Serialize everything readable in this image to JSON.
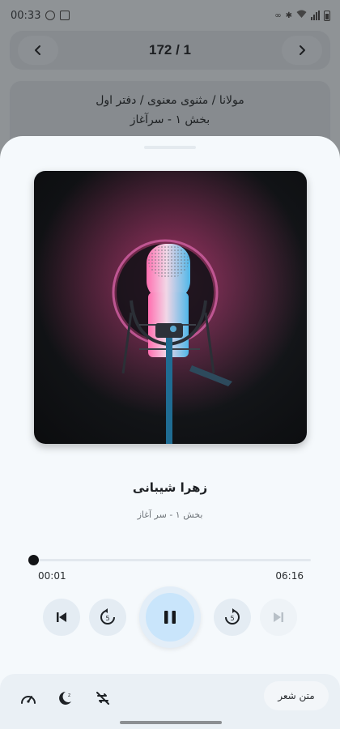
{
  "status_bar": {
    "time": "00:33",
    "icons": [
      "chrome-icon",
      "gallery-icon",
      "link-icon",
      "bluetooth-icon",
      "wifi-icon",
      "signal-icon",
      "battery-icon"
    ]
  },
  "pager": {
    "label": "172 / 1",
    "prev_icon": "chevron-left-icon",
    "next_icon": "chevron-right-icon"
  },
  "breadcrumb": {
    "path": "مولانا / مثنوی معنوی / دفتر اول",
    "section": "بخش ۱ - سرآغاز"
  },
  "player": {
    "artwork": "microphone-photo",
    "title": "زهرا شیبانی",
    "subtitle": "بخش ۱ - سر آغاز",
    "elapsed": "00:01",
    "duration": "06:16",
    "progress": 0.003
  },
  "controls": {
    "previous_icon": "skip-previous-icon",
    "rewind_icon": "replay-5-icon",
    "play_pause_icon": "pause-icon",
    "forward_icon": "forward-5-icon",
    "next_icon": "skip-next-icon"
  },
  "bottom_bar": {
    "poem_text_label": "متن شعر",
    "speed_icon": "speedometer-icon",
    "sleep_timer_icon": "sleep-timer-icon",
    "no_repeat_icon": "repeat-off-icon"
  },
  "colors": {
    "sheet_background": "#f5f9fc",
    "play_button": "#c9e5fb",
    "scrim": "#8f9396"
  }
}
